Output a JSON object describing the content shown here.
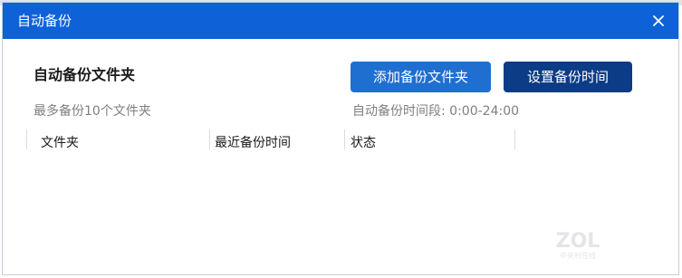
{
  "dialog": {
    "title": "自动备份",
    "close_icon": "close-icon"
  },
  "header": {
    "section_title": "自动备份文件夹",
    "add_button": "添加备份文件夹",
    "set_time_button": "设置备份时间",
    "max_folders_text": "最多备份10个文件夹",
    "time_range_text": "自动备份时间段:   0:00-24:00"
  },
  "table": {
    "columns": [
      "文件夹",
      "最近备份时间",
      "状态"
    ],
    "rows": []
  },
  "colors": {
    "titlebar": "#0f61d8",
    "add_button": "#1f6fd1",
    "set_time_button": "#0c3c86"
  },
  "watermark": {
    "main": "ZOL",
    "sub": "中关村在线"
  }
}
